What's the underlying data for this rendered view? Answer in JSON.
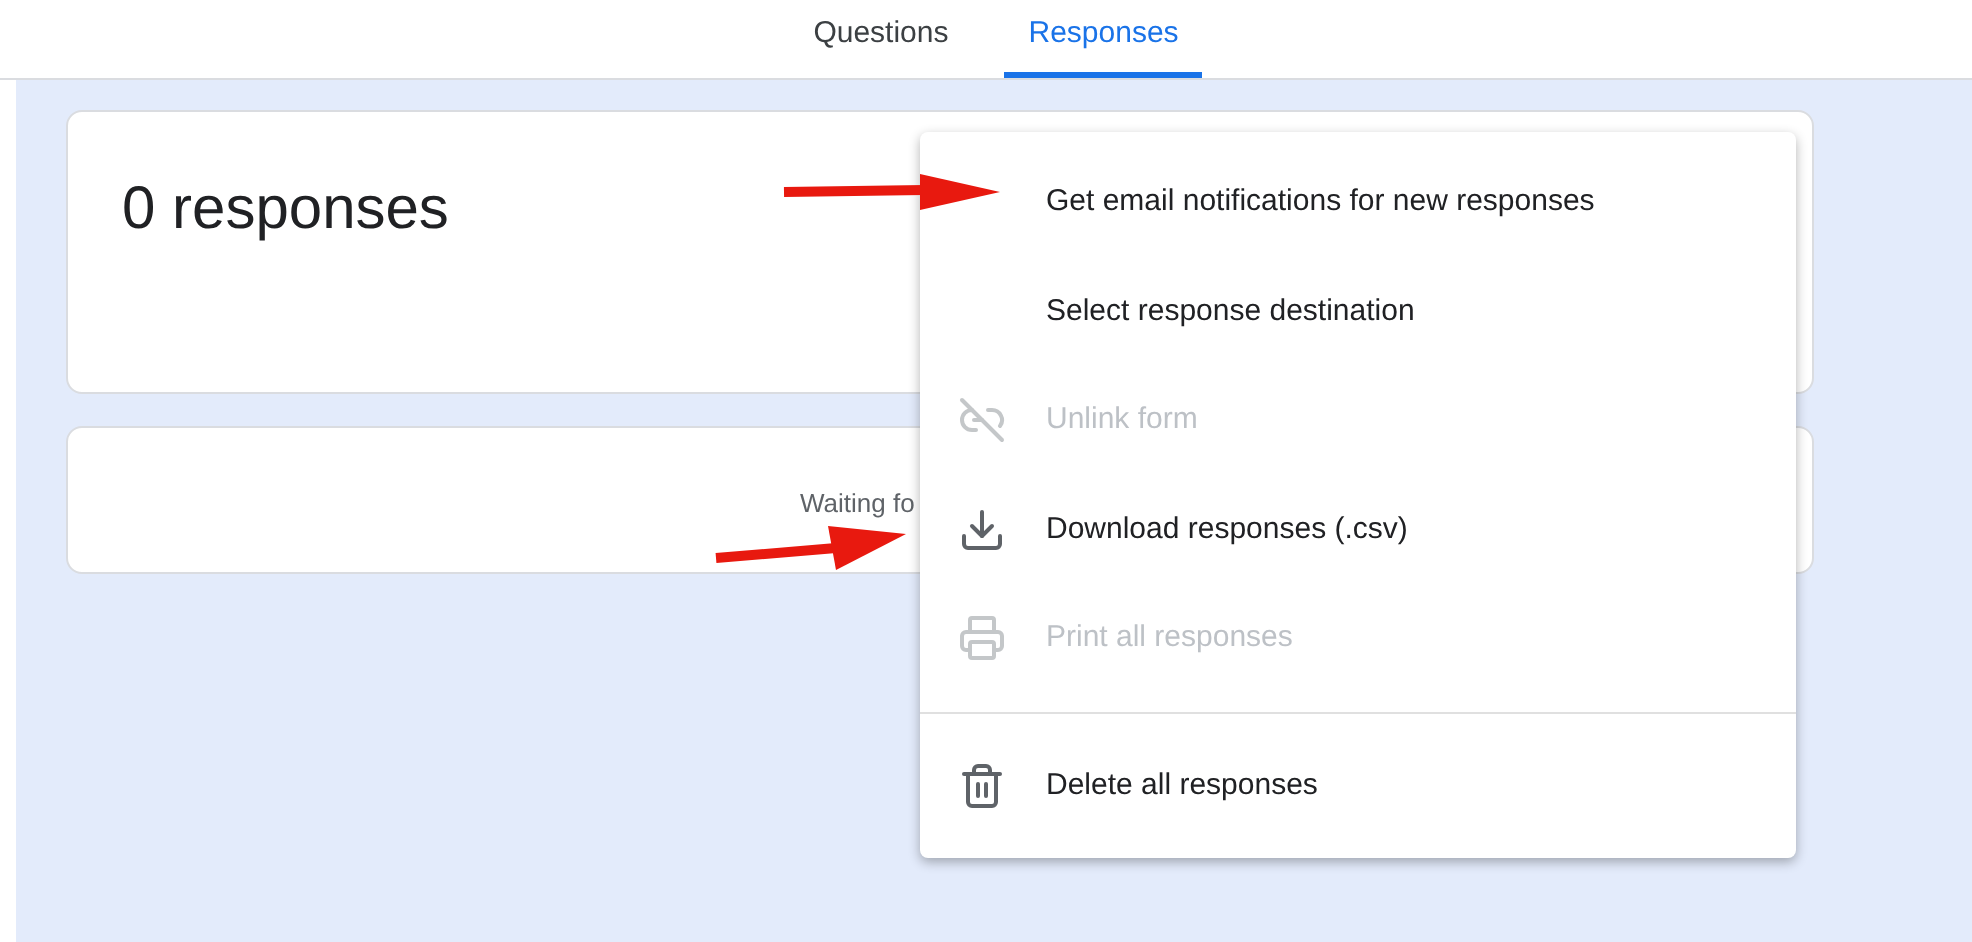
{
  "tabs": [
    {
      "label": "Questions",
      "selected": false
    },
    {
      "label": "Responses",
      "selected": true
    }
  ],
  "summary_card": {
    "title": "0 responses"
  },
  "status_card": {
    "text": "Waiting fo"
  },
  "menu": {
    "sections": [
      [
        {
          "kind": "plain",
          "label": "Get email notifications for new responses",
          "disabled": false
        },
        {
          "kind": "plain",
          "label": "Select response destination",
          "disabled": false
        },
        {
          "kind": "unlink",
          "label": "Unlink form",
          "disabled": true
        },
        {
          "kind": "download",
          "label": "Download responses (.csv)",
          "disabled": false
        },
        {
          "kind": "print",
          "label": "Print all responses",
          "disabled": true
        }
      ],
      [
        {
          "kind": "delete",
          "label": "Delete all responses",
          "disabled": false
        }
      ]
    ]
  }
}
